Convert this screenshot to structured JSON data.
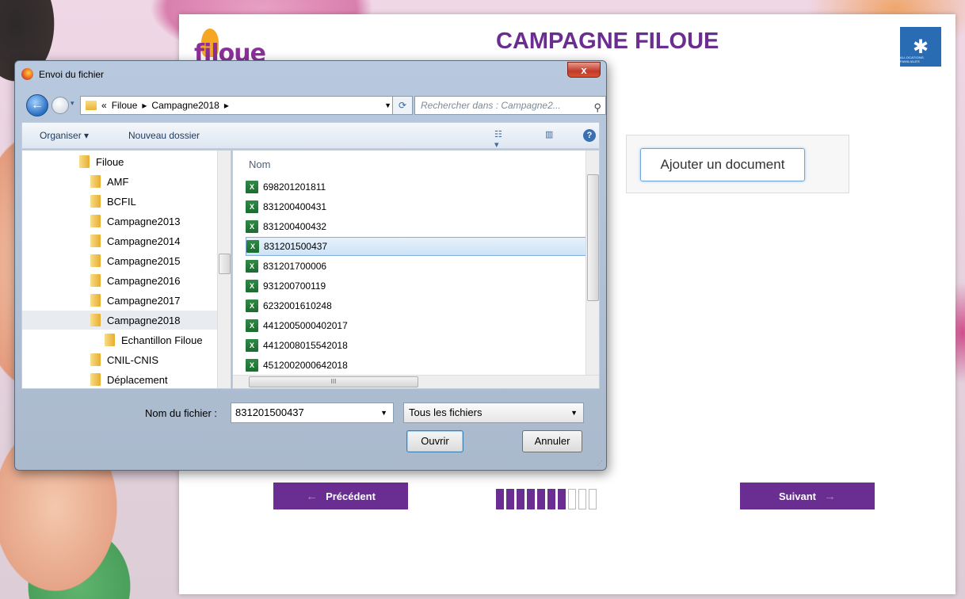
{
  "page": {
    "title": "CAMPAGNE FILOUE",
    "logo_text": "filoue",
    "caf_label": "ALLOCATIONS FAMILIALES",
    "add_document": "Ajouter un document",
    "prev_label": "Précédent",
    "next_label": "Suivant",
    "progress": {
      "done": 7,
      "total": 10
    },
    "accent": "#6a2d91"
  },
  "dialog": {
    "title": "Envoi du fichier",
    "close_label": "x",
    "breadcrumb": [
      "«",
      "Filoue",
      "Campagne2018"
    ],
    "search_placeholder": "Rechercher dans : Campagne2...",
    "toolbar": {
      "organize": "Organiser ▾",
      "new_folder": "Nouveau dossier"
    },
    "tree": [
      {
        "label": "Filoue"
      },
      {
        "label": "AMF"
      },
      {
        "label": "BCFIL"
      },
      {
        "label": "Campagne2013"
      },
      {
        "label": "Campagne2014"
      },
      {
        "label": "Campagne2015"
      },
      {
        "label": "Campagne2016"
      },
      {
        "label": "Campagne2017"
      },
      {
        "label": "Campagne2018"
      },
      {
        "label": "Echantillon Filoue"
      },
      {
        "label": "CNIL-CNIS"
      },
      {
        "label": "Déplacement"
      }
    ],
    "column_name": "Nom",
    "files": [
      "698201201811",
      "831200400431",
      "831200400432",
      "831201500437",
      "831201700006",
      "931200700119",
      "6232001610248",
      "4412005000402017",
      "4412008015542018",
      "4512002000642018"
    ],
    "filename_label": "Nom du fichier :",
    "filename_value": "831201500437",
    "filter_value": "Tous les fichiers",
    "open_label": "Ouvrir",
    "cancel_label": "Annuler"
  }
}
